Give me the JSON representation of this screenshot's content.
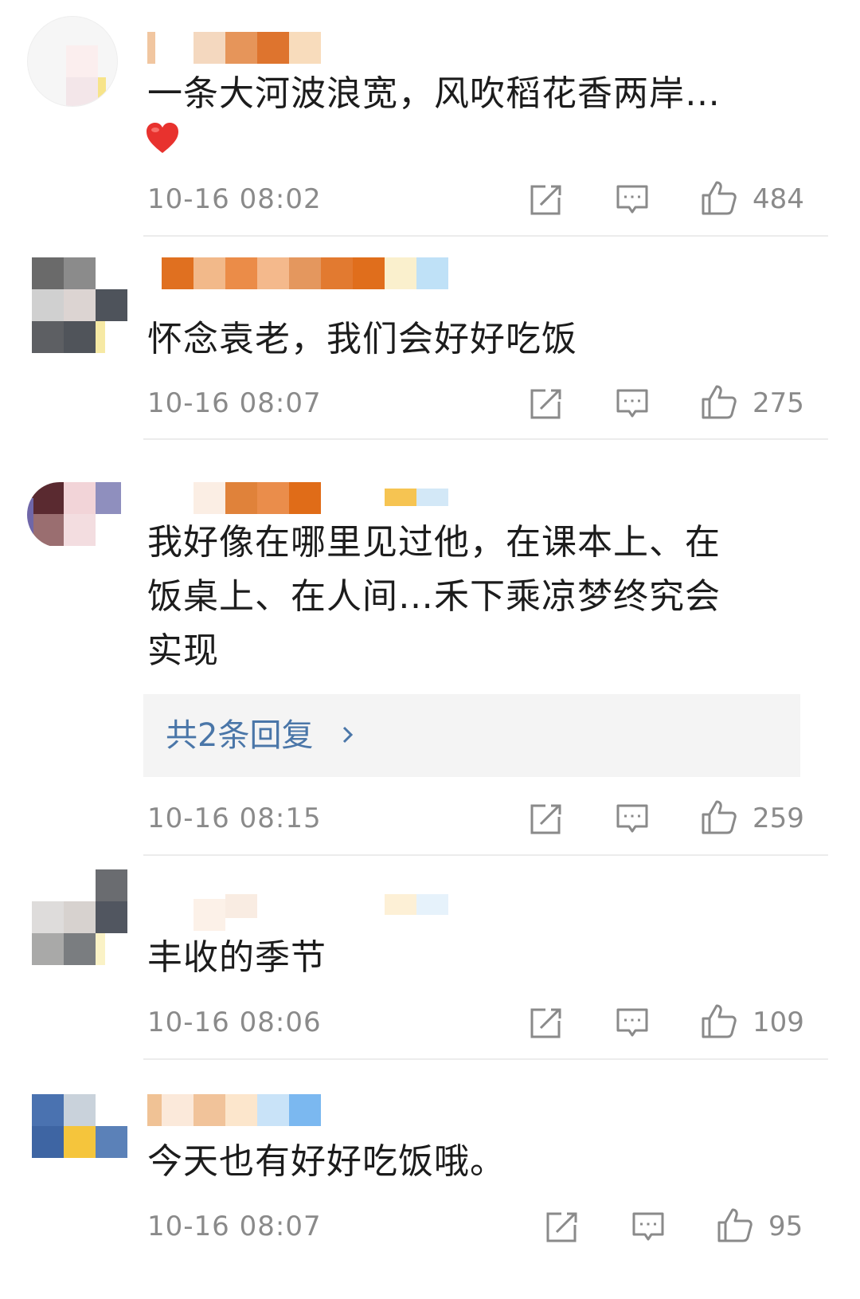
{
  "comments": [
    {
      "text": "一条大河波浪宽，风吹稻花香两岸…",
      "emoji": "heart",
      "time": "10-16 08:02",
      "likes": "484"
    },
    {
      "text": "怀念袁老，我们会好好吃饭",
      "time": "10-16 08:07",
      "likes": "275"
    },
    {
      "text_lines": [
        "我好像在哪里见过他，在课本上、在",
        "饭桌上、在人间…禾下乘凉梦终究会",
        "实现"
      ],
      "replies": "共2条回复",
      "time": "10-16 08:15",
      "likes": "259"
    },
    {
      "text": "丰收的季节",
      "time": "10-16 08:06",
      "likes": "109"
    },
    {
      "text": "今天也有好好吃饭哦。",
      "time": "10-16 08:07",
      "likes": "95"
    }
  ],
  "icons": {
    "share": "share-icon",
    "comment": "comment-icon",
    "like": "like-icon",
    "chevron": "chevron-right-icon"
  },
  "colors": {
    "link": "#4a76a8",
    "meta": "#8a8a8a",
    "text": "#1c1c1c",
    "heart": "#e8322e"
  }
}
